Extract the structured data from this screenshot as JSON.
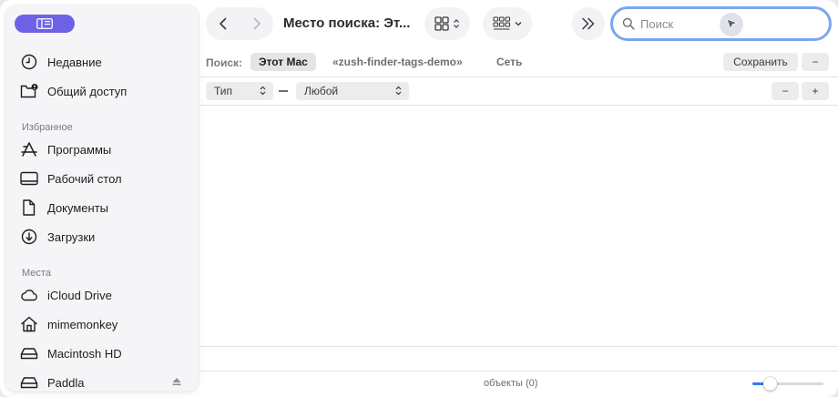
{
  "sidebar": {
    "sections": {
      "favorites": "Избранное",
      "locations": "Места"
    },
    "recents": [
      {
        "label": "Недавние",
        "icon": "clock-icon"
      },
      {
        "label": "Общий доступ",
        "icon": "shared-folder-icon"
      }
    ],
    "favorites": [
      {
        "label": "Программы",
        "icon": "applications-icon"
      },
      {
        "label": "Рабочий стол",
        "icon": "desktop-icon"
      },
      {
        "label": "Документы",
        "icon": "document-icon"
      },
      {
        "label": "Загрузки",
        "icon": "downloads-icon"
      }
    ],
    "locations": [
      {
        "label": "iCloud Drive",
        "icon": "cloud-icon"
      },
      {
        "label": "mimemonkey",
        "icon": "home-icon"
      },
      {
        "label": "Macintosh HD",
        "icon": "disk-icon"
      },
      {
        "label": "Paddla",
        "icon": "disk-icon",
        "ejectable": true
      }
    ]
  },
  "toolbar": {
    "title": "Место поиска: Эт...",
    "search_placeholder": "Поиск",
    "search_value": ""
  },
  "scope": {
    "label": "Поиск:",
    "options": [
      "Этот Mac",
      "«zush-finder-tags-demo»",
      "Сеть"
    ],
    "active_index": 0,
    "save_label": "Сохранить",
    "remove_label": "−"
  },
  "criteria": {
    "attribute": "Тип",
    "value": "Любой",
    "remove_label": "−",
    "add_label": "+"
  },
  "status": {
    "items_text": "объекты (0)",
    "icon_size_fraction": 0.25
  },
  "colors": {
    "accent": "#3478f6",
    "sidebar_toggle": "#6d62e6",
    "search_focus_ring": "#7aa6ee"
  }
}
